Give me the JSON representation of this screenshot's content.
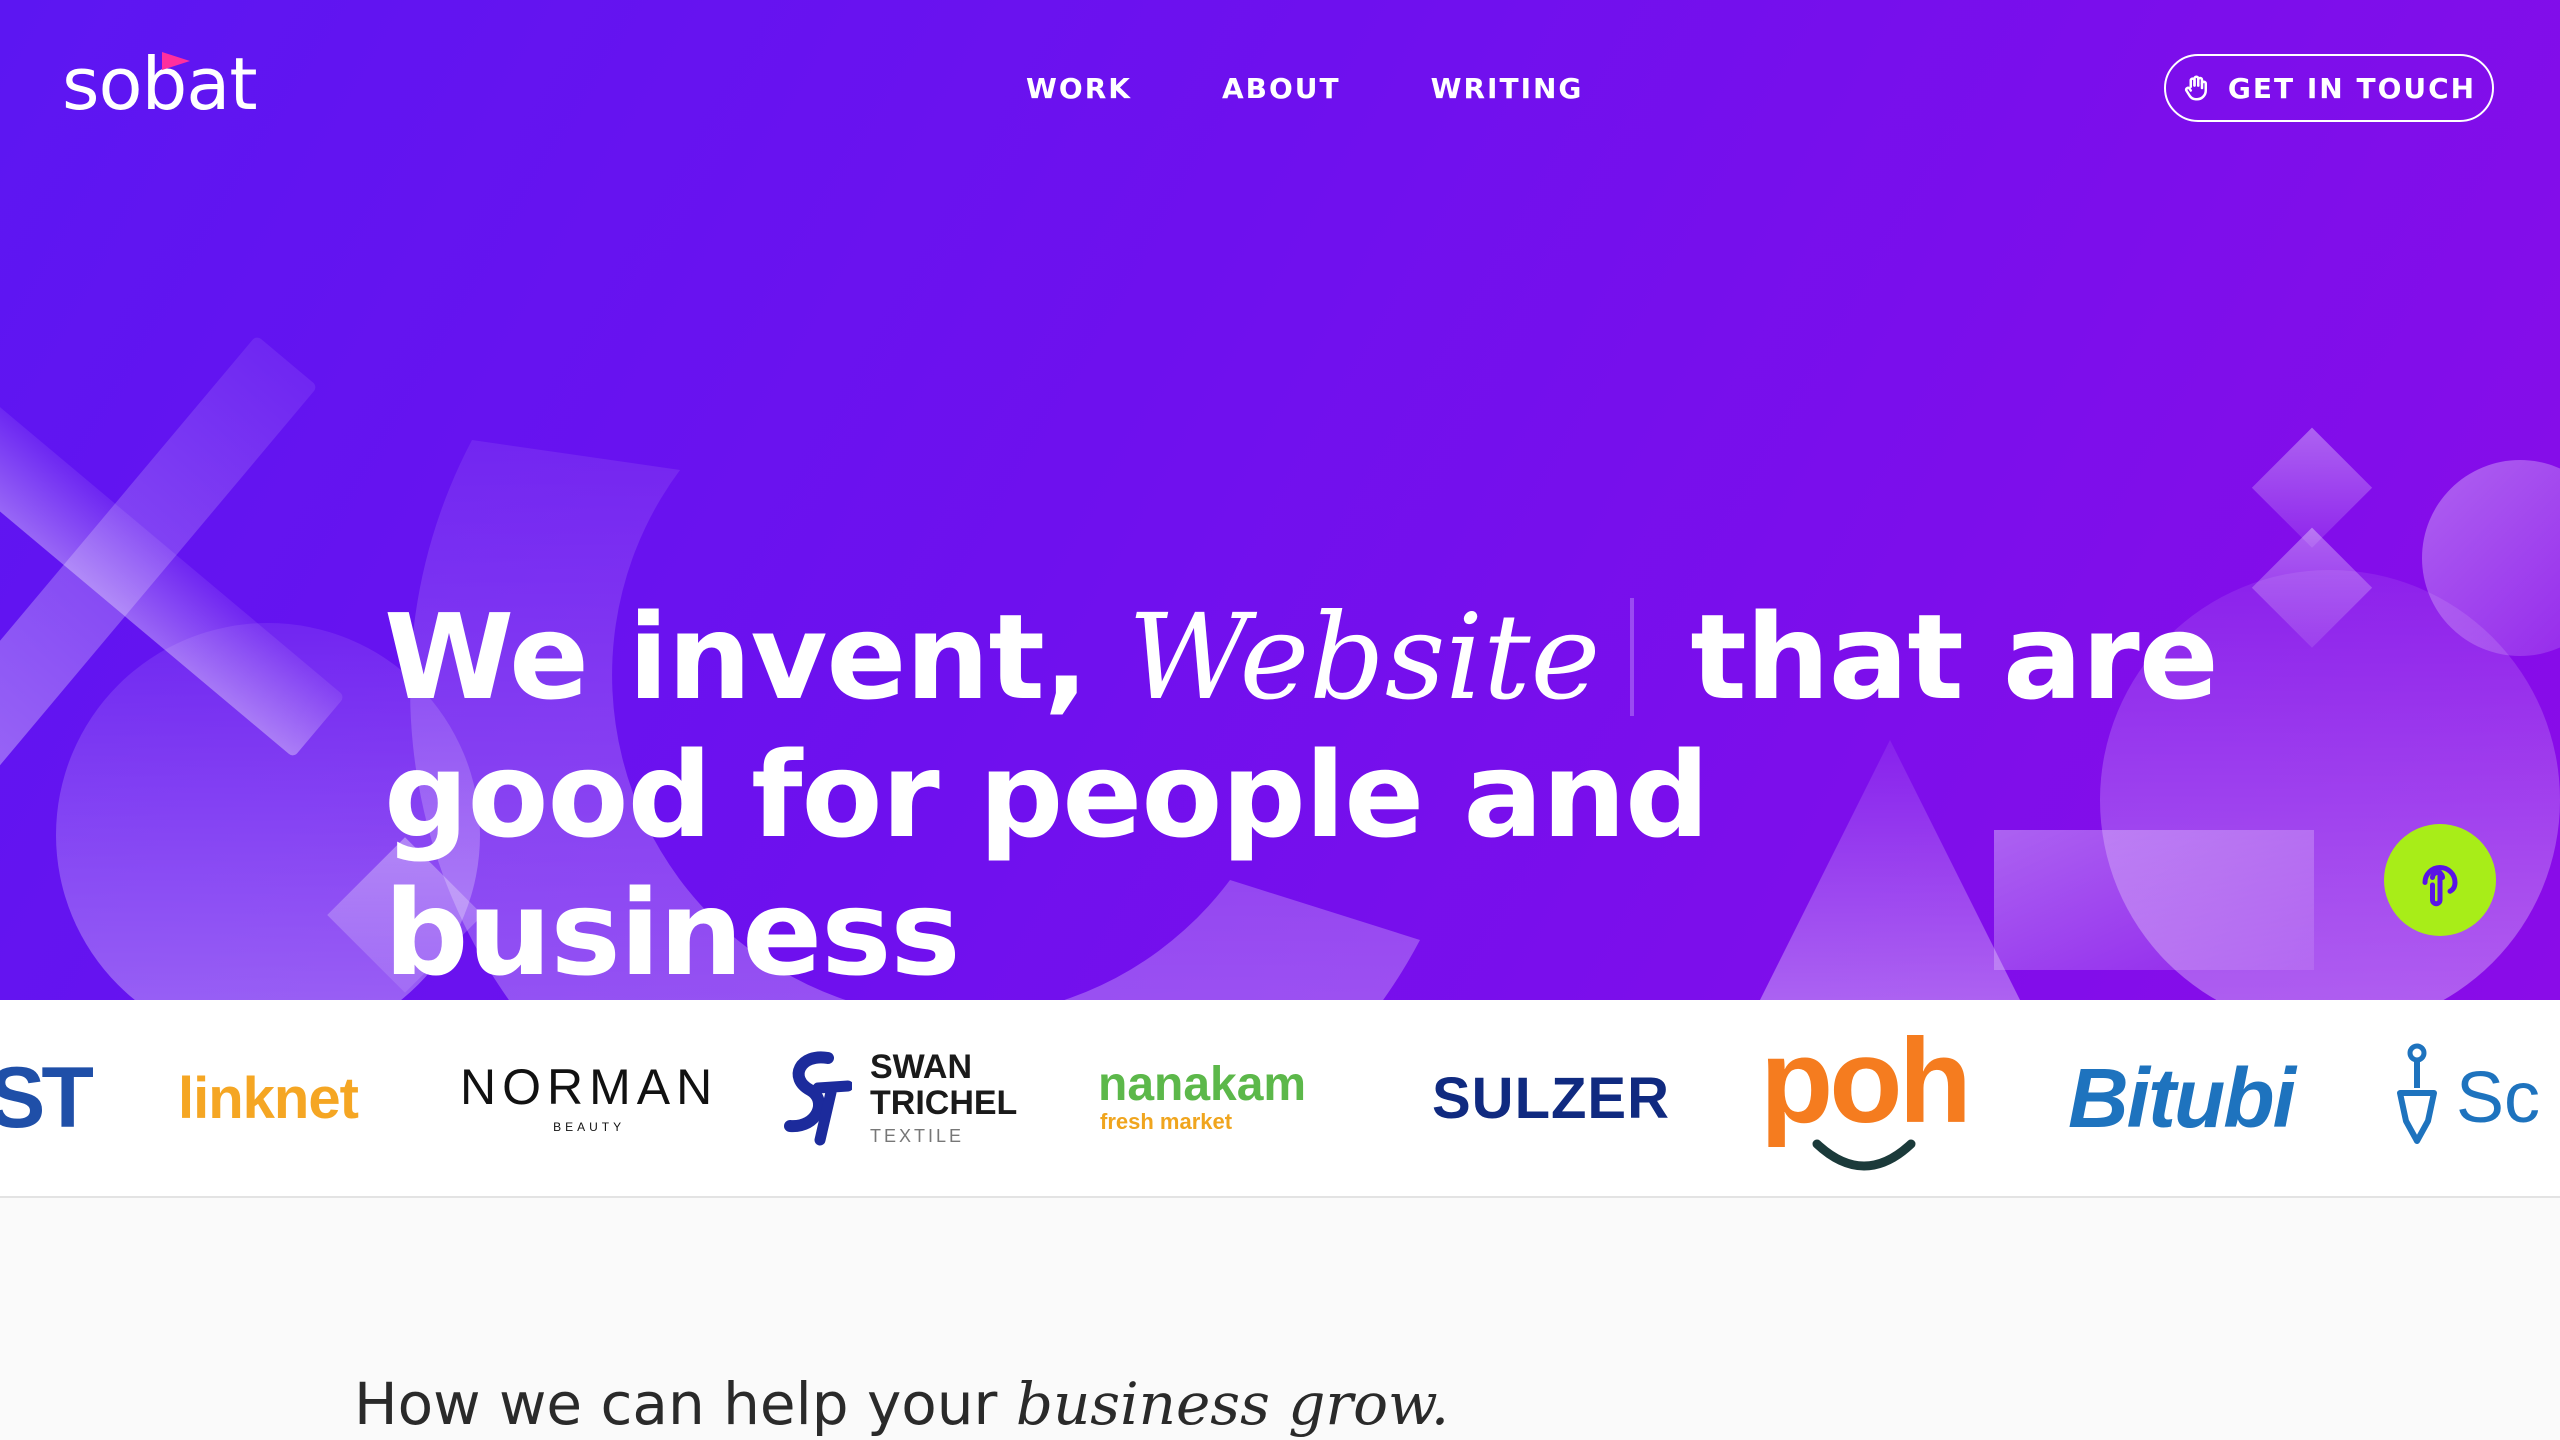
{
  "brand": {
    "logo_text": "sobat"
  },
  "nav": {
    "links": [
      {
        "label": "WORK"
      },
      {
        "label": "ABOUT"
      },
      {
        "label": "WRITING"
      }
    ],
    "cta_label": "GET IN TOUCH",
    "cta_icon": "hand-wave-icon"
  },
  "hero": {
    "headline_part1": "We invent,",
    "rotating_word": "Website",
    "headline_part2": "that are",
    "headline_line2": "good for people and business",
    "fab_icon": "pointing-hand-icon",
    "colors": {
      "gradient_start": "#5c16f2",
      "gradient_end": "#8a0ce8",
      "fab": "#a8ed18"
    }
  },
  "clients": {
    "partial_left": "ST",
    "linknet": "linknet",
    "norman": "NORMAN",
    "norman_sub": "BEAUTY",
    "swan_line1": "SWAN",
    "swan_line2": "TRICHEL",
    "swan_sub": "TEXTILE",
    "nanakam": "nanakam",
    "nanakam_sub": "fresh market",
    "sulzer": "SULZER",
    "poh": "poh",
    "bitubi": "Bitubi",
    "partial_right": "Sc"
  },
  "services": {
    "title_plain": "How we can help your",
    "title_emphasis": "business grow."
  }
}
